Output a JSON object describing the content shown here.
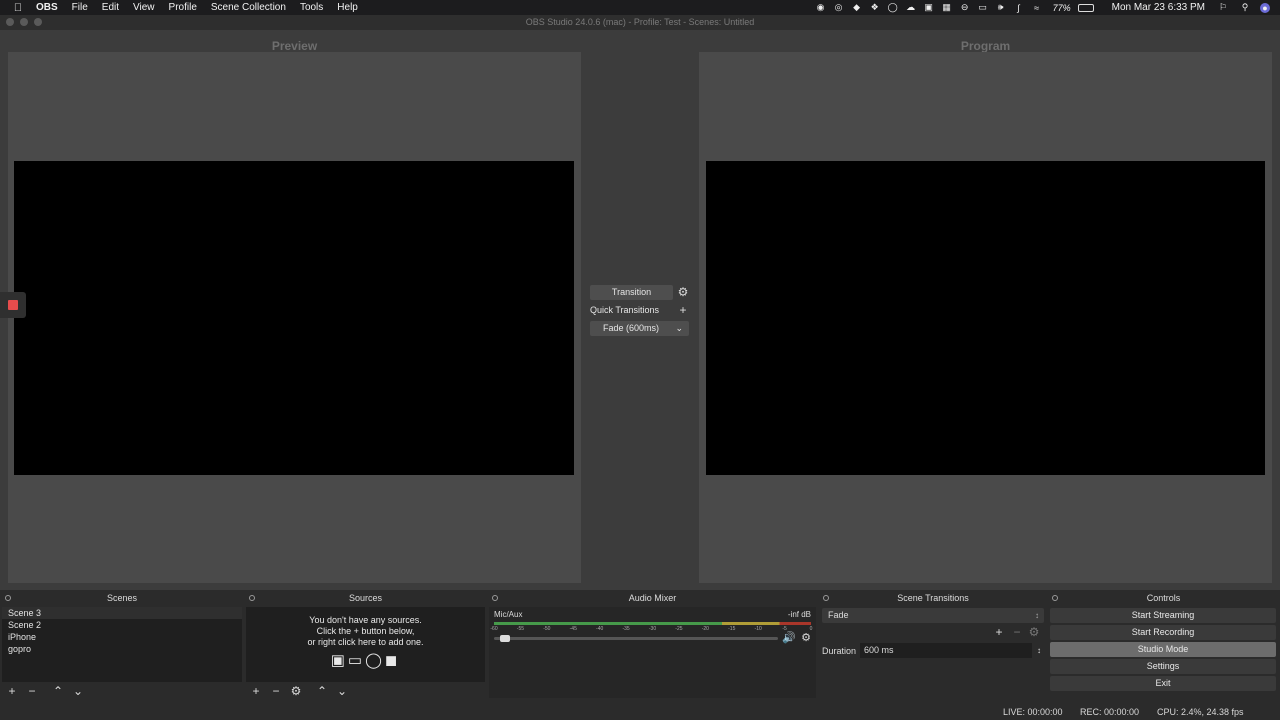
{
  "menubar": {
    "app_name": "OBS",
    "items": [
      "File",
      "Edit",
      "View",
      "Profile",
      "Scene Collection",
      "Tools",
      "Help"
    ],
    "battery": "77%",
    "clock": "Mon Mar 23  6:33 PM",
    "status_icons": [
      "creative-cloud-icon",
      "vpn-icon",
      "evernote-icon",
      "dropbox-icon",
      "creative-cloud-sync-icon",
      "icloud-icon",
      "bluetooth-icon-2",
      "display-icon",
      "do-not-disturb-icon",
      "airplay-icon",
      "volume-icon",
      "bluetooth-icon",
      "wifi-icon"
    ]
  },
  "window": {
    "title": "OBS Studio 24.0.6 (mac) - Profile: Test - Scenes: Untitled"
  },
  "preview": {
    "title": "Preview"
  },
  "program": {
    "title": "Program"
  },
  "transition_panel": {
    "transition_label": "Transition",
    "quick_transitions_label": "Quick Transitions",
    "fade_label": "Fade (600ms)"
  },
  "scenes": {
    "title": "Scenes",
    "items": [
      "Scene 3",
      "Scene 2",
      "iPhone",
      "gopro"
    ],
    "selected_index": 0
  },
  "sources": {
    "title": "Sources",
    "empty_line1": "You don't have any sources.",
    "empty_line2": "Click the + button below,",
    "empty_line3": "or right click here to add one."
  },
  "audio_mixer": {
    "title": "Audio Mixer",
    "track_name": "Mic/Aux",
    "level": "-inf dB",
    "ticks": [
      "-60",
      "-55",
      "-50",
      "-45",
      "-40",
      "-35",
      "-30",
      "-25",
      "-20",
      "-15",
      "-10",
      "-5",
      "0"
    ],
    "volume_fraction": 0.02
  },
  "scene_transitions": {
    "title": "Scene Transitions",
    "selected": "Fade",
    "duration_label": "Duration",
    "duration_value": "600 ms"
  },
  "controls": {
    "title": "Controls",
    "start_streaming": "Start Streaming",
    "start_recording": "Start Recording",
    "studio_mode": "Studio Mode",
    "settings": "Settings",
    "exit": "Exit"
  },
  "status": {
    "live": "LIVE: 00:00:00",
    "rec": "REC: 00:00:00",
    "cpu": "CPU: 2.4%, 24.38 fps"
  },
  "colors": {
    "recording_indicator": "#e74c4c",
    "meter_green": "#4caf50",
    "meter_yellow": "#c9b23a",
    "meter_red": "#c0392b"
  }
}
